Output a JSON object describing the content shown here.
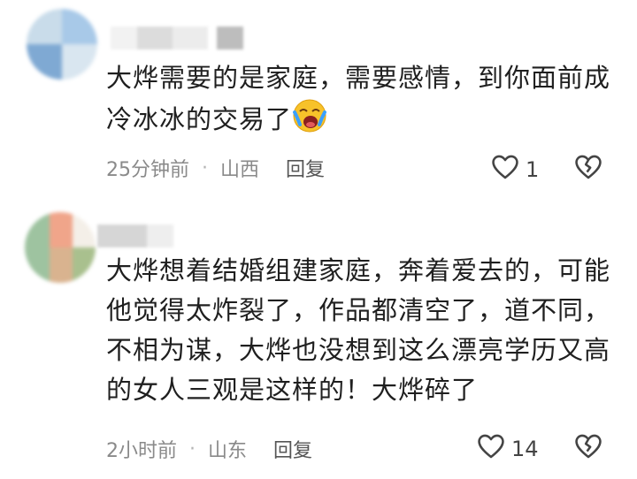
{
  "comments": [
    {
      "text_lines": [
        "大烨需要的是家庭，需要感情，到你面前成",
        "冷冰冰的交易了"
      ],
      "emoji": "crying-face-icon",
      "time": "25分钟前",
      "separator": "·",
      "location": "山西",
      "reply_label": "回复",
      "like_count": "1"
    },
    {
      "text_lines": [
        "大烨想着结婚组建家庭，奔着爱去的，可能",
        "他觉得太炸裂了，作品都清空了，道不同，",
        "不相为谋，大烨也没想到这么漂亮学历又高",
        "的女人三观是这样的！大烨碎了"
      ],
      "time": "2小时前",
      "separator": "·",
      "location": "山东",
      "reply_label": "回复",
      "like_count": "14"
    }
  ],
  "colors": {
    "text": "#1f1f1f",
    "meta": "#8a8a8a",
    "icon": "#444444"
  }
}
